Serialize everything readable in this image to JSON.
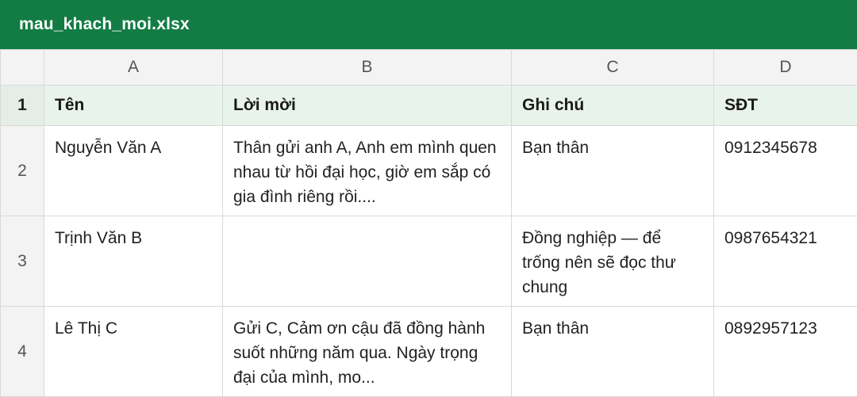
{
  "window": {
    "title": "mau_khach_moi.xlsx"
  },
  "colors": {
    "titlebar": "#127c44",
    "header_row": "#e8f3ec",
    "grid_line": "#d9d9d9"
  },
  "sheet": {
    "column_letters": [
      "A",
      "B",
      "C",
      "D"
    ],
    "row_numbers": [
      "1",
      "2",
      "3",
      "4"
    ],
    "header": {
      "name": "Tên",
      "invite": "Lời mời",
      "note": "Ghi chú",
      "phone": "SĐT"
    },
    "rows": [
      {
        "name": "Nguyễn Văn A",
        "invite": "Thân gửi anh A, Anh em mình quen nhau từ hồi đại học, giờ em sắp có gia đình riêng rồi....",
        "note": "Bạn thân",
        "phone": "0912345678"
      },
      {
        "name": "Trịnh Văn B",
        "invite": "",
        "note": "Đồng nghiệp — để trống nên sẽ đọc thư chung",
        "phone": "0987654321"
      },
      {
        "name": "Lê Thị C",
        "invite": "Gửi C, Cảm ơn cậu đã đồng hành suốt những năm qua. Ngày trọng đại của mình, mo...",
        "note": "Bạn thân",
        "phone": "0892957123"
      }
    ]
  }
}
